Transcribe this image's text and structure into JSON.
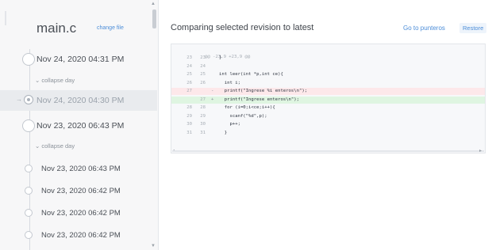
{
  "file": {
    "name": "main.c",
    "change_label": "change file"
  },
  "history": [
    {
      "kind": "revision",
      "label": "Nov 24, 2020 04:31 PM",
      "selected": false
    },
    {
      "kind": "collapse",
      "label": "collapse day"
    },
    {
      "kind": "revision",
      "label": "Nov 24, 2020 04:30 PM",
      "selected": true
    },
    {
      "kind": "revision",
      "label": "Nov 23, 2020 06:43 PM",
      "selected": false
    },
    {
      "kind": "collapse",
      "label": "collapse day"
    },
    {
      "kind": "revision",
      "label": "Nov 23, 2020 06:43 PM",
      "selected": false
    },
    {
      "kind": "revision",
      "label": "Nov 23, 2020 06:42 PM",
      "selected": false
    },
    {
      "kind": "revision",
      "label": "Nov 23, 2020 06:42 PM",
      "selected": false
    },
    {
      "kind": "revision",
      "label": "Nov 23, 2020 06:42 PM",
      "selected": false
    }
  ],
  "compare": {
    "title": "Comparing selected revision to latest",
    "goto_label": "Go to punteros",
    "restore_label": "Restore"
  },
  "diff": {
    "hunk_header": "@@ -23,9 +23,9 @@",
    "lines": [
      {
        "old": "23",
        "new": "23",
        "type": "context",
        "text": "}"
      },
      {
        "old": "24",
        "new": "24",
        "type": "context",
        "text": ""
      },
      {
        "old": "25",
        "new": "25",
        "type": "context",
        "text": "int leer(int *p,int ce){"
      },
      {
        "old": "26",
        "new": "26",
        "type": "context",
        "text": "  int i;"
      },
      {
        "old": "27",
        "new": "",
        "type": "removed",
        "text": "  printf(\"Ingrese %i enteros\\n\");"
      },
      {
        "old": "",
        "new": "27",
        "type": "added",
        "text": "  printf(\"Ingrese enteros\\n\");"
      },
      {
        "old": "28",
        "new": "28",
        "type": "context",
        "text": "  for (i=0;i<ce;i++){"
      },
      {
        "old": "29",
        "new": "29",
        "type": "context",
        "text": "    scanf(\"%d\",p);"
      },
      {
        "old": "30",
        "new": "30",
        "type": "context",
        "text": "    p++;"
      },
      {
        "old": "31",
        "new": "31",
        "type": "context",
        "text": "  }"
      }
    ]
  },
  "colors": {
    "accent": "#4c8dd8",
    "removed_bg": "#fde8ea",
    "added_bg": "#dff5e1"
  },
  "icons": {
    "revision": "circle-node-icon",
    "selected_revision": "radio-selected-icon",
    "collapse": "chevron-down-icon",
    "scroll_up": "triangle-up-icon",
    "scroll_down": "triangle-down-icon"
  }
}
